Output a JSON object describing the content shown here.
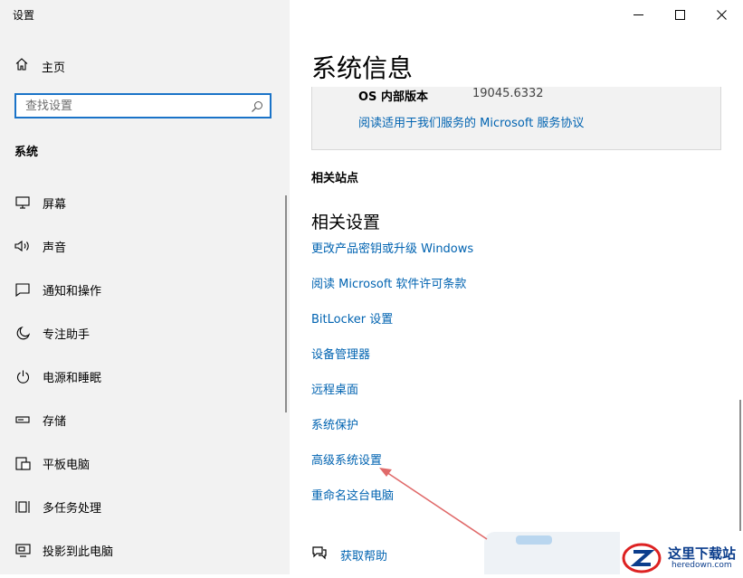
{
  "app": {
    "title": "设置"
  },
  "sidebar": {
    "home_label": "主页",
    "search_placeholder": "查找设置",
    "section_title": "系统",
    "items": [
      {
        "label": "屏幕",
        "icon": "monitor-icon"
      },
      {
        "label": "声音",
        "icon": "speaker-icon"
      },
      {
        "label": "通知和操作",
        "icon": "notification-icon"
      },
      {
        "label": "专注助手",
        "icon": "moon-icon"
      },
      {
        "label": "电源和睡眠",
        "icon": "power-icon"
      },
      {
        "label": "存储",
        "icon": "storage-icon"
      },
      {
        "label": "平板电脑",
        "icon": "tablet-icon"
      },
      {
        "label": "多任务处理",
        "icon": "multitask-icon"
      },
      {
        "label": "投影到此电脑",
        "icon": "project-icon"
      }
    ]
  },
  "window_controls": [
    "minimize-icon",
    "maximize-icon",
    "close-icon"
  ],
  "main": {
    "title": "系统信息",
    "info": {
      "key": "OS 内部版本",
      "value": "19045.6332",
      "link": "阅读适用于我们服务的 Microsoft 服务协议"
    },
    "related_sites_heading": "相关站点",
    "related_settings_heading": "相关设置",
    "related_links": [
      "更改产品密钥或升级 Windows",
      "阅读 Microsoft 软件许可条款",
      "BitLocker 设置",
      "设备管理器",
      "远程桌面",
      "系统保护",
      "高级系统设置",
      "重命名这台电脑"
    ],
    "help_label": "获取帮助"
  },
  "colors": {
    "accent": "#0063b1",
    "focus_border": "#1a73c8",
    "sidebar_bg": "#f2f2f2",
    "annotation_arrow": "#e06a6a"
  },
  "watermark": {
    "name": "这里下载站",
    "url": "heredown.com"
  }
}
